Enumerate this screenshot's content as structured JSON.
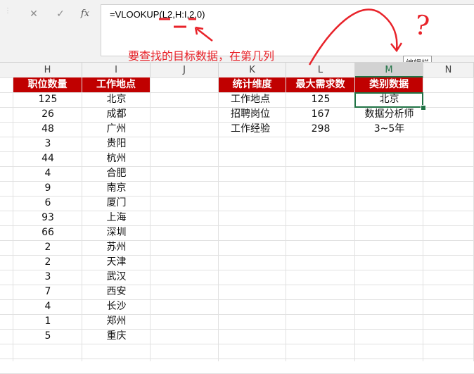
{
  "formula_bar": {
    "cancel_icon": "✕",
    "enter_icon": "✓",
    "function_label": "fx",
    "formula": "=VLOOKUP(L2,H:I,2,0)"
  },
  "annotation": {
    "text": "要查找的目标数据，在第几列",
    "question_mark": "?",
    "color": "#e8232a"
  },
  "tooltip": "编辑栏",
  "columns": [
    "H",
    "I",
    "J",
    "K",
    "L",
    "M",
    "N"
  ],
  "active_column": "M",
  "left_table": {
    "headers": [
      "职位数量",
      "工作地点"
    ],
    "rows": [
      [
        "125",
        "北京"
      ],
      [
        "26",
        "成都"
      ],
      [
        "48",
        "广州"
      ],
      [
        "3",
        "贵阳"
      ],
      [
        "44",
        "杭州"
      ],
      [
        "4",
        "合肥"
      ],
      [
        "9",
        "南京"
      ],
      [
        "6",
        "厦门"
      ],
      [
        "93",
        "上海"
      ],
      [
        "66",
        "深圳"
      ],
      [
        "2",
        "苏州"
      ],
      [
        "2",
        "天津"
      ],
      [
        "3",
        "武汉"
      ],
      [
        "7",
        "西安"
      ],
      [
        "4",
        "长沙"
      ],
      [
        "1",
        "郑州"
      ],
      [
        "5",
        "重庆"
      ]
    ]
  },
  "right_table": {
    "headers": [
      "统计维度",
      "最大需求数",
      "类别数据"
    ],
    "rows": [
      [
        "工作地点",
        "125",
        "北京"
      ],
      [
        "招聘岗位",
        "167",
        "数据分析师"
      ],
      [
        "工作经验",
        "298",
        "3~5年"
      ]
    ]
  },
  "colors": {
    "header_fill": "#c00000",
    "selection": "#217346",
    "annotation": "#e8232a"
  }
}
